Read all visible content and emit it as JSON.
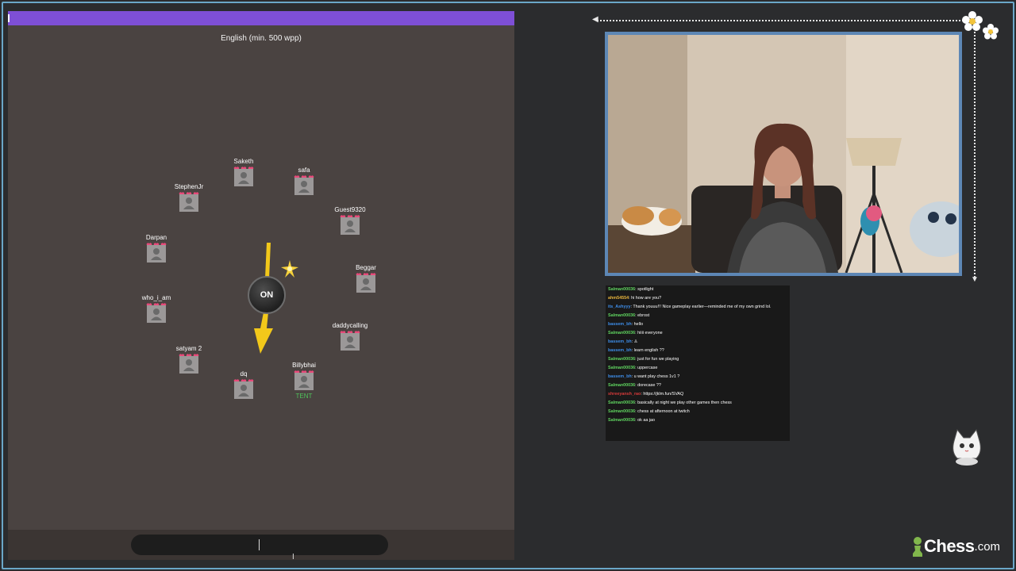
{
  "game": {
    "language": "English (min. 500 wpp)",
    "bomb_label": "ON",
    "players": [
      {
        "name": "Saketh"
      },
      {
        "name": "safa"
      },
      {
        "name": "Guest9320"
      },
      {
        "name": "Beggar"
      },
      {
        "name": "daddycalling"
      },
      {
        "name": "Billybhai",
        "tag": "TENT"
      },
      {
        "name": "dq"
      },
      {
        "name": "satyam 2"
      },
      {
        "name": "who_i_am"
      },
      {
        "name": "Darpan"
      },
      {
        "name": "StephenJr"
      }
    ],
    "input_value": ""
  },
  "chat": {
    "messages": [
      {
        "user": "Salman00036",
        "text": "spotlight",
        "color": "#5fd35f"
      },
      {
        "user": "ahm54554",
        "text": "hi how are you?",
        "color": "#e6b43c"
      },
      {
        "user": "its_Ashyyy",
        "text": "Thank youuu!!! Nice gameplay earlier—reminded me of my own grind lol.",
        "color": "#3e8eea"
      },
      {
        "user": "Salman00036",
        "text": "ebrost",
        "color": "#5fd35f"
      },
      {
        "user": "bassem_bh",
        "text": "hello",
        "color": "#3e8eea"
      },
      {
        "user": "Salman00036",
        "text": "hiiii everyone",
        "color": "#5fd35f"
      },
      {
        "user": "bassem_bh",
        "text": "♙",
        "color": "#3e8eea"
      },
      {
        "user": "bassem_bh",
        "text": "learn english ??",
        "color": "#3e8eea"
      },
      {
        "user": "Salman00036",
        "text": "just for fun we playing",
        "color": "#5fd35f"
      },
      {
        "user": "Salman00036",
        "text": "uppercase",
        "color": "#5fd35f"
      },
      {
        "user": "bassem_bh",
        "text": "u want play chess 1v1 ?",
        "color": "#3e8eea"
      },
      {
        "user": "Salman00036",
        "text": "dorecase ??",
        "color": "#5fd35f"
      },
      {
        "user": "shreeyansh_rao",
        "text": "https://jklm.fun/SVAQ",
        "color": "#d63a3a"
      },
      {
        "user": "Salman00036",
        "text": "basically at night we play other games then chess",
        "color": "#5fd35f"
      },
      {
        "user": "Salman00036",
        "text": "chess at afternoon at twitch",
        "color": "#5fd35f"
      },
      {
        "user": "Salman00036",
        "text": "ok aa jao",
        "color": "#5fd35f"
      }
    ]
  },
  "brand": {
    "name": "Chess",
    "suffix": ".com"
  },
  "colors": {
    "accent_purple": "#7e4fd6",
    "game_bg": "#4a4341",
    "cam_border": "#5d87b5",
    "page_bg": "#2b2c2e",
    "heart": "#e84a7a",
    "bomb_arrow": "#f2c81a"
  }
}
